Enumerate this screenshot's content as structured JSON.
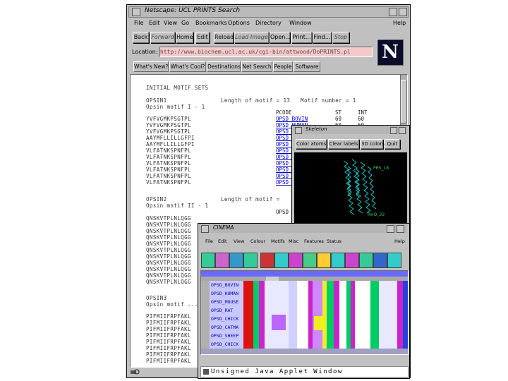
{
  "netscape": {
    "title": "Netscape: UCL PRINTS Search",
    "menu": [
      "File",
      "Edit",
      "View",
      "Go",
      "Bookmarks",
      "Options",
      "Directory",
      "Window",
      "Help"
    ],
    "toolbar": [
      "Back",
      "Forward",
      "Home",
      "Edit",
      "Reload",
      "Load Images",
      "Open...",
      "Print...",
      "Find...",
      "Stop"
    ],
    "location_label": "Location:",
    "location_value": "http://www.biochem.ucl.ac.uk/cgi-bin/attwood/DoPRINTS.pl",
    "logo_letter": "N",
    "directory_buttons": [
      "What's New?",
      "What's Cool?",
      "Destinations",
      "Net Search",
      "People",
      "Software"
    ],
    "content": {
      "heading": "INITIAL MOTIF SETS",
      "motif1_name": "OPSIN1",
      "motif1_info": "Length of motif = 13   Motif number = 1",
      "motif1_subtitle": "Opsin motif I - 1",
      "table_header": [
        "PCODE",
        "ST",
        "INT"
      ],
      "motif1_codes": [
        "OPSD_BOVIN",
        "OPSD_HUMAN",
        "OPSD_...",
        "OPSD_...",
        "OPSD_...",
        "OPSD_...",
        "OPSD_...",
        "OPSD_...",
        "OPSD_...",
        "OPSD_...",
        "OPSD_..."
      ],
      "motif1_st": [
        "60",
        "60"
      ],
      "motif1_int": [
        "60",
        "60"
      ],
      "motif1_seqs": [
        "YVFVGMKPSGTPL",
        "YVFVGMKPSGTPL",
        "YVFVGMKPSGTPL",
        "AAYMFLLILLGFPI",
        "AAYMFLLILLGFPI",
        "VLFATNKSPNFPL",
        "VLFATNKSPNFPL",
        "VLFATNKSPNFPL",
        "VLFATNKSPNFPL",
        "VLFATNKSPNFPL",
        "VLFATNKSPNFPL"
      ],
      "motif2_name": "OPSIN2",
      "motif2_info": "Length of motif =",
      "motif2_subtitle": "Opsin motif II - 1",
      "motif2_code": "OPSD",
      "motif2_seqs": [
        "QNSKVTPLNLQGG",
        "QNSKVTPLNLQGG",
        "QNSKVTPLNLQGG",
        "QNSKVTPLNLQGG",
        "QNSKVTPLNLQGG",
        "QNSKVTPLNLQGG",
        "QNSKVTPLNLQGG",
        "QNSKVTPLNLQGG",
        "QNSKVTPLNLQGG",
        "QNSKVTPLNLQGG",
        "QNSKVTPLNLQGG"
      ],
      "motif3_name": "OPSIN3",
      "motif3_subtitle": "Opsin motif ...",
      "motif3_seqs": [
        "PIFMIIFRPFAKL",
        "PIFMIIFRPFAKL",
        "PIFMIIFRPFAKL",
        "PIFMIIFRPFAKL",
        "PIFMIIFRPFAKL",
        "PIFMIIFRPFAKL",
        "PIFMIIFRPFAKL",
        "PIFMIIFRPFAKL"
      ]
    }
  },
  "skeleton": {
    "title": "Skeleton",
    "buttons": [
      "Color atoms",
      "Clear labels",
      "3D colors",
      "Quit"
    ],
    "labels": [
      "PRS_18",
      "RHO_33"
    ],
    "colors": {
      "chain": "#22cccc",
      "label": "#33cc66"
    }
  },
  "cinema": {
    "title": "CINEMA",
    "menu": [
      "File",
      "Edit",
      "View",
      "Colour",
      "Motifs",
      "Misc",
      "Features",
      "Status",
      "Help"
    ],
    "tools": [
      "load",
      "open",
      "save",
      "print",
      "find",
      "col1",
      "col2",
      "col3",
      "col4",
      "col5",
      "col6",
      "col7",
      "col8",
      "col9",
      "col10",
      "col11"
    ],
    "rows": [
      "OPSD_BOVIN",
      "OPSD_HUMAN",
      "OPSD_MOUSE",
      "OPSD_RAT",
      "OPSD_CHICK",
      "OPSD_CATMA",
      "OPSD_SHEEP",
      "OPSD_CHICK"
    ],
    "status_text": "Unsigned Java Applet Window",
    "colors": {
      "green": "#00cc66",
      "magenta": "#cc22cc",
      "red": "#dd1111",
      "blue": "#2244dd",
      "yellow": "#eeee22",
      "violet": "#bb66ff"
    }
  }
}
